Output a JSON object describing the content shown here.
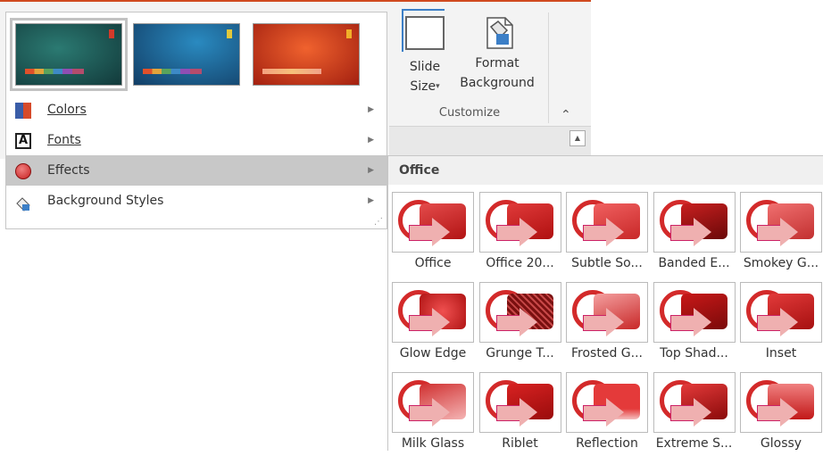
{
  "ribbon": {
    "slide_size_label_1": "Slide",
    "slide_size_label_2": "Size",
    "format_bg_label_1": "Format",
    "format_bg_label_2": "Background",
    "group_label": "Customize",
    "caret": "▾",
    "collapse_glyph": "⌃",
    "scroll_glyph": "▲"
  },
  "themes": [
    {
      "name": "theme-teal",
      "color": "#1e5a5a"
    },
    {
      "name": "theme-blue",
      "color": "#1f5a8a"
    },
    {
      "name": "theme-red",
      "color": "#c23a1a"
    }
  ],
  "menu": {
    "items": [
      {
        "label": "Colors",
        "icon": "colors-icon"
      },
      {
        "label": "Fonts",
        "icon": "fonts-icon"
      },
      {
        "label": "Effects",
        "icon": "effects-icon"
      },
      {
        "label": "Background Styles",
        "icon": "background-styles-icon"
      }
    ],
    "fonts_glyph": "A",
    "arrow": "▶",
    "grip": "⋰"
  },
  "effects": {
    "header": "Office",
    "items": [
      "Office",
      "Office 20...",
      "Subtle So...",
      "Banded E...",
      "Smokey G...",
      "Glow Edge",
      "Grunge T...",
      "Frosted G...",
      "Top Shad...",
      "Inset",
      "Milk Glass",
      "Riblet",
      "Reflection",
      "Extreme S...",
      "Glossy"
    ]
  },
  "colors": {
    "accent_orange": "#d04a1f",
    "highlight_gray": "#c8c8c8",
    "effect_red": "#c62020"
  }
}
